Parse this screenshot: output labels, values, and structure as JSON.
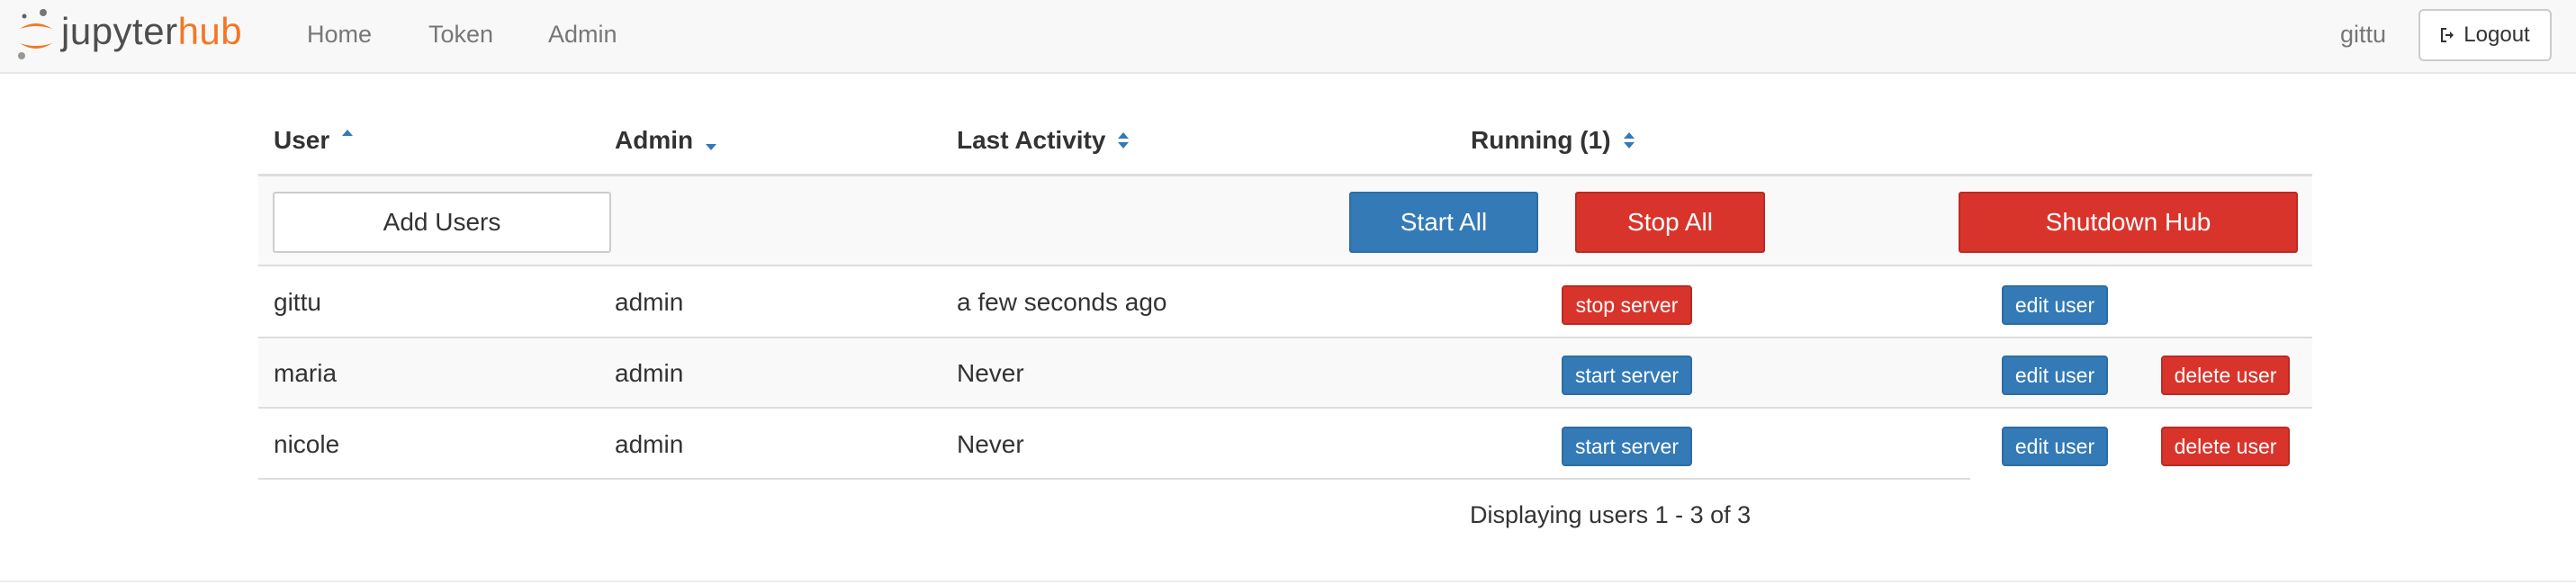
{
  "navbar": {
    "brand": {
      "part1": "jupyter",
      "part2": "hub"
    },
    "links": [
      {
        "label": "Home"
      },
      {
        "label": "Token"
      },
      {
        "label": "Admin"
      }
    ],
    "username": "gittu",
    "logout_label": "Logout"
  },
  "table": {
    "columns": [
      {
        "label": "User",
        "sort": "ascending"
      },
      {
        "label": "Admin",
        "sort": "descending"
      },
      {
        "label": "Last Activity",
        "sort": "unsorted"
      },
      {
        "label": "Running (1)",
        "sort": "unsorted"
      }
    ],
    "actions": {
      "add_users": "Add Users",
      "start_all": "Start All",
      "stop_all": "Stop All",
      "shutdown_hub": "Shutdown Hub"
    },
    "rows": [
      {
        "user": "gittu",
        "admin": "admin",
        "last_activity": "a few seconds ago",
        "server_action": "stop server",
        "edit": "edit user",
        "delete": ""
      },
      {
        "user": "maria",
        "admin": "admin",
        "last_activity": "Never",
        "server_action": "start server",
        "edit": "edit user",
        "delete": "delete user"
      },
      {
        "user": "nicole",
        "admin": "admin",
        "last_activity": "Never",
        "server_action": "start server",
        "edit": "edit user",
        "delete": "delete user"
      }
    ],
    "footer": "Displaying users 1 - 3 of 3"
  },
  "colors": {
    "primary": "#337ab7",
    "danger": "#d9342b",
    "brand_orange": "#f37726"
  }
}
